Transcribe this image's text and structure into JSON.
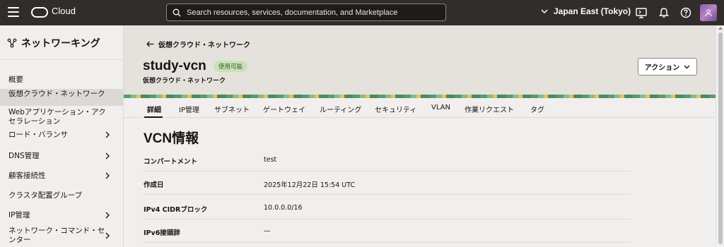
{
  "topbar": {
    "brand": "Cloud",
    "search_placeholder": "Search resources, services, documentation, and Marketplace",
    "region": "Japan East (Tokyo)"
  },
  "sidebar": {
    "title": "ネットワーキング",
    "items": [
      {
        "label": "概要",
        "active": false,
        "chevron": false
      },
      {
        "label": "仮想クラウド・ネットワーク",
        "active": true,
        "chevron": false
      },
      {
        "label": "Webアプリケーション・アクセラレーション",
        "active": false,
        "chevron": false
      },
      {
        "label": "ロード・バランサ",
        "active": false,
        "chevron": true
      },
      {
        "label": "DNS管理",
        "active": false,
        "chevron": true
      },
      {
        "label": "顧客接続性",
        "active": false,
        "chevron": true
      },
      {
        "label": "クラスタ配置グループ",
        "active": false,
        "chevron": false
      },
      {
        "label": "IP管理",
        "active": false,
        "chevron": true
      },
      {
        "label": "ネットワーク・コマンド・センター",
        "active": false,
        "chevron": true
      }
    ]
  },
  "header": {
    "back_label": "仮想クラウド・ネットワーク",
    "name": "study-vcn",
    "status_badge": "使用可能",
    "subtitle": "仮想クラウド・ネットワーク",
    "action_label": "アクション"
  },
  "tabs": [
    "詳細",
    "IP管理",
    "サブネット",
    "ゲートウェイ",
    "ルーティング",
    "セキュリティ",
    "VLAN",
    "作業リクエスト",
    "タグ"
  ],
  "active_tab": "詳細",
  "section": {
    "title": "VCN情報",
    "rows": [
      {
        "key": "コンパートメント",
        "value": "test"
      },
      {
        "key": "作成日",
        "value": "2025年12月22日 15:54 UTC"
      },
      {
        "key": "IPv4 CIDRブロック",
        "value": "10.0.0.0/16"
      },
      {
        "key": "IPv6接頭辞",
        "value": "—"
      }
    ]
  },
  "colors": {
    "topbar_bg": "#312d2a",
    "badge_bg": "#c9e1b9",
    "badge_text": "#2c5c1a"
  }
}
